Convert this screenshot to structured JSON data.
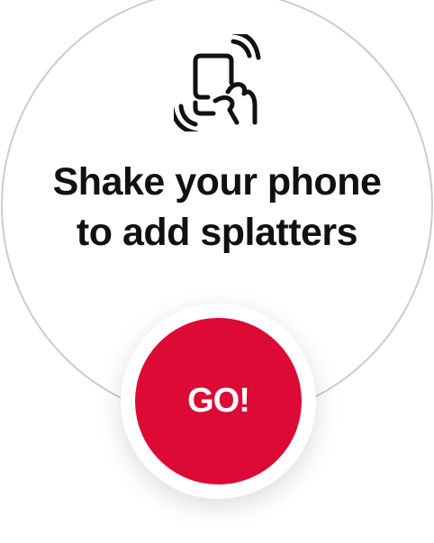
{
  "prompt": {
    "icon": "shake-phone-icon",
    "line1": "Shake your phone",
    "line2": "to add splatters"
  },
  "go_button": {
    "label": "GO!"
  },
  "colors": {
    "accent": "#dc0a35",
    "text": "#111111",
    "circle_border": "#cccccc",
    "background": "#ffffff"
  }
}
